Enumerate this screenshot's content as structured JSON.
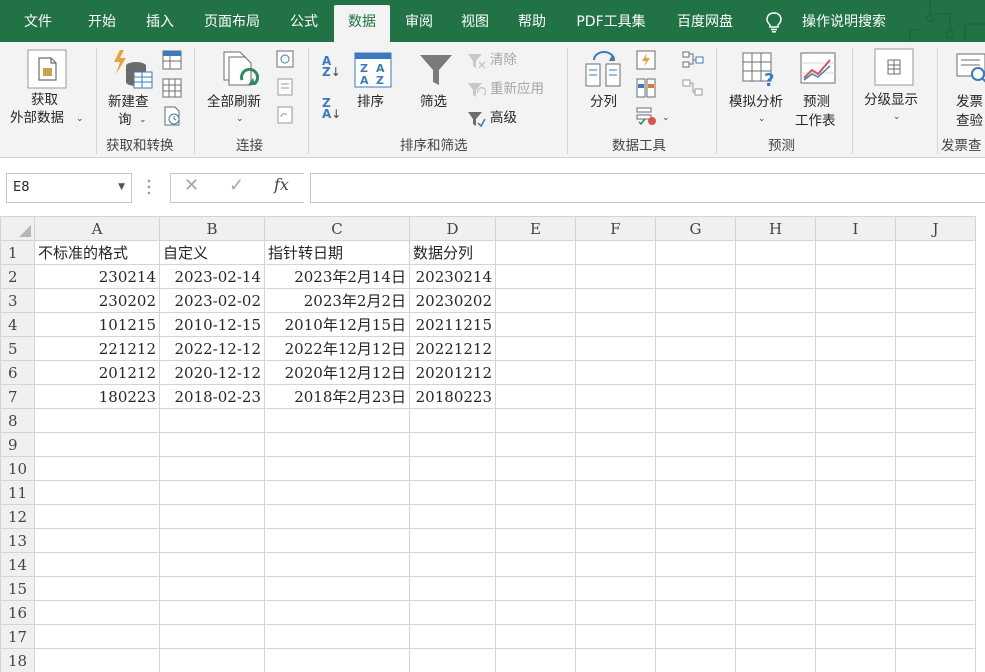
{
  "tabs": [
    {
      "label": "文件",
      "active": false
    },
    {
      "label": "开始",
      "active": false
    },
    {
      "label": "插入",
      "active": false
    },
    {
      "label": "页面布局",
      "active": false
    },
    {
      "label": "公式",
      "active": false
    },
    {
      "label": "数据",
      "active": true
    },
    {
      "label": "审阅",
      "active": false
    },
    {
      "label": "视图",
      "active": false
    },
    {
      "label": "帮助",
      "active": false
    },
    {
      "label": "PDF工具集",
      "active": false
    },
    {
      "label": "百度网盘",
      "active": false
    }
  ],
  "tell_me": "操作说明搜索",
  "ribbon": {
    "get_external": {
      "line1": "获取",
      "line2": "外部数据"
    },
    "new_query": {
      "line1": "新建查",
      "line2": "询"
    },
    "group_get_transform": "获取和转换",
    "refresh_all": "全部刷新",
    "group_connections": "连接",
    "sort": "排序",
    "filter": "筛选",
    "clear": "清除",
    "reapply": "重新应用",
    "advanced": "高级",
    "group_sort_filter": "排序和筛选",
    "text_to_columns": "分列",
    "group_data_tools": "数据工具",
    "what_if": "模拟分析",
    "forecast_sheet": {
      "line1": "预测",
      "line2": "工作表"
    },
    "group_forecast": "预测",
    "outline": "分级显示",
    "invoice": {
      "line1": "发票",
      "line2": "查验"
    },
    "group_invoice": "发票查",
    "colors": {
      "accent": "#217346",
      "ribbon_bg": "#f3f3f3"
    }
  },
  "formula_bar": {
    "name_box": "E8",
    "fx": "fx",
    "value": ""
  },
  "sheet": {
    "columns": [
      "A",
      "B",
      "C",
      "D",
      "E",
      "F",
      "G",
      "H",
      "I",
      "J"
    ],
    "rows": [
      {
        "n": "1",
        "cells": [
          "不标准的格式",
          "自定义",
          "指针转日期",
          "数据分列"
        ]
      },
      {
        "n": "2",
        "cells": [
          "230214",
          "2023-02-14",
          "2023年2月14日",
          "20230214"
        ]
      },
      {
        "n": "3",
        "cells": [
          "230202",
          "2023-02-02",
          "2023年2月2日",
          "20230202"
        ]
      },
      {
        "n": "4",
        "cells": [
          "101215",
          "2010-12-15",
          "2010年12月15日",
          "20211215"
        ]
      },
      {
        "n": "5",
        "cells": [
          "221212",
          "2022-12-12",
          "2022年12月12日",
          "20221212"
        ]
      },
      {
        "n": "6",
        "cells": [
          "201212",
          "2020-12-12",
          "2020年12月12日",
          "20201212"
        ]
      },
      {
        "n": "7",
        "cells": [
          "180223",
          "2018-02-23",
          "2018年2月23日",
          "20180223"
        ]
      },
      {
        "n": "8",
        "cells": [
          "",
          "",
          "",
          ""
        ]
      },
      {
        "n": "9",
        "cells": [
          "",
          "",
          "",
          ""
        ]
      },
      {
        "n": "10",
        "cells": [
          "",
          "",
          "",
          ""
        ]
      },
      {
        "n": "11",
        "cells": [
          "",
          "",
          "",
          ""
        ]
      },
      {
        "n": "12",
        "cells": [
          "",
          "",
          "",
          ""
        ]
      },
      {
        "n": "13",
        "cells": [
          "",
          "",
          "",
          ""
        ]
      },
      {
        "n": "14",
        "cells": [
          "",
          "",
          "",
          ""
        ]
      },
      {
        "n": "15",
        "cells": [
          "",
          "",
          "",
          ""
        ]
      },
      {
        "n": "16",
        "cells": [
          "",
          "",
          "",
          ""
        ]
      },
      {
        "n": "17",
        "cells": [
          "",
          "",
          "",
          ""
        ]
      },
      {
        "n": "18",
        "cells": [
          "",
          "",
          "",
          ""
        ]
      }
    ]
  }
}
